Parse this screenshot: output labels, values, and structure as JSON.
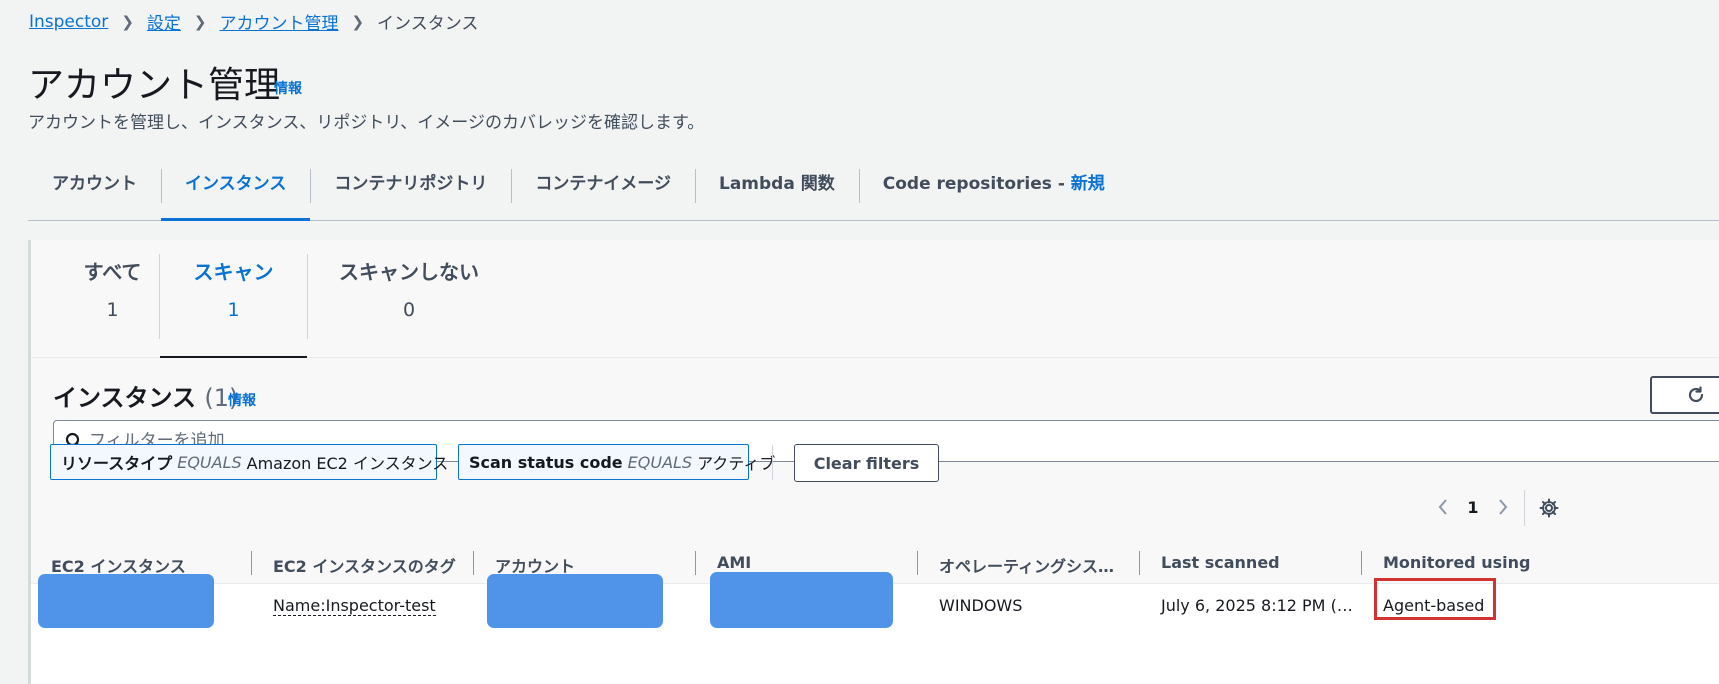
{
  "breadcrumb": {
    "items": [
      "Inspector",
      "設定",
      "アカウント管理"
    ],
    "current": "インスタンス"
  },
  "page": {
    "title": "アカウント管理",
    "info": "情報",
    "description": "アカウントを管理し、インスタンス、リポジトリ、イメージのカバレッジを確認します。"
  },
  "tabs": {
    "items": [
      "アカウント",
      "インスタンス",
      "コンテナリポジトリ",
      "コンテナイメージ",
      "Lambda 関数"
    ],
    "code_repos": "Code repositories - ",
    "new_badge": "新規",
    "active": "インスタンス"
  },
  "scan_tabs": [
    {
      "label": "すべて",
      "count": "1"
    },
    {
      "label": "スキャン",
      "count": "1"
    },
    {
      "label": "スキャンしない",
      "count": "0"
    }
  ],
  "section": {
    "title": "インスタンス",
    "count": "(1)",
    "info": "情報"
  },
  "search": {
    "placeholder": "フィルターを追加"
  },
  "filters": [
    {
      "key": "リソースタイプ",
      "op": "EQUALS",
      "value": "Amazon EC2 インスタンス"
    },
    {
      "key": "Scan status code",
      "op": "EQUALS",
      "value": "アクティブ"
    }
  ],
  "clear_filters": "Clear filters",
  "pagination": {
    "page": "1"
  },
  "table": {
    "columns": [
      "EC2 インスタンス",
      "EC2 インスタンスのタグ",
      "アカウント",
      "AMI",
      "オペレーティングシス…",
      "Last scanned",
      "Monitored using"
    ],
    "rows": [
      {
        "tag": "Name:Inspector-test",
        "os": "WINDOWS",
        "last_scanned": "July 6, 2025 8:12 PM (…",
        "monitored_using": "Agent-based"
      }
    ]
  },
  "colors": {
    "accent": "#0972d3",
    "highlight": "#d13232",
    "redaction": "#4f94e8"
  }
}
